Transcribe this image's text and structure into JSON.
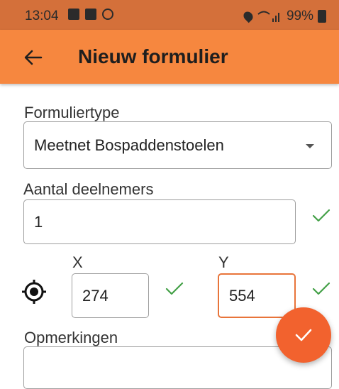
{
  "status_bar": {
    "time": "13:04",
    "battery": "99%"
  },
  "app_bar": {
    "title": "Nieuw formulier",
    "back_icon": "arrow-left-icon"
  },
  "form": {
    "type_label": "Formuliertype",
    "type_value": "Meetnet Bospaddenstoelen",
    "participants_label": "Aantal deelnemers",
    "participants_value": "1",
    "x_label": "X",
    "x_value": "274",
    "y_label": "Y",
    "y_value": "554",
    "remarks_label": "Opmerkingen",
    "remarks_value": ""
  },
  "colors": {
    "accent": "#f6873f",
    "status_bar": "#d4703a",
    "fab": "#f2622e",
    "check": "#43a047"
  },
  "icons": {
    "locate": "gps-fixed-icon",
    "fab": "check-icon",
    "valid": "checkmark-icon"
  }
}
